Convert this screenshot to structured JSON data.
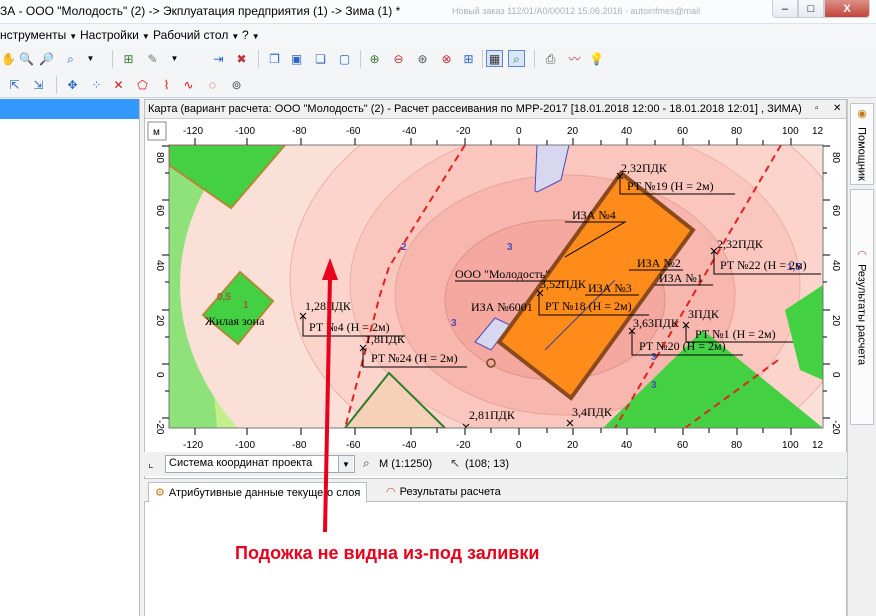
{
  "window": {
    "title": "ЗА - ООО \"Молодость\" (2) -> Экплуатация предприятия (1) -> Зима (1) *",
    "title_extra": "Новый заказ 112/01/А0/00012 15.06.2016 · autoinfmes@mail",
    "min_label": "–",
    "max_label": "□",
    "close_label": "X"
  },
  "menu": {
    "items": [
      {
        "label": "нструменты"
      },
      {
        "label": "Настройки"
      },
      {
        "label": "Рабочий стол"
      },
      {
        "label": "?"
      }
    ]
  },
  "map": {
    "title": "Карта (вариант расчета: ООО \"Молодость\" (2) - Расчет рассеивания по МРР-2017 [18.01.2018 12:00 - 18.01.2018 12:01] , ЗИМА)",
    "unit_label": "м",
    "x_ticks": [
      "-120",
      "-100",
      "-80",
      "-60",
      "-40",
      "-20",
      "0",
      "20",
      "40",
      "60",
      "80",
      "100",
      "12"
    ],
    "y_ticks": [
      "80",
      "60",
      "40",
      "20",
      "0",
      "-20"
    ],
    "residential_zone_label": "Жилая зона",
    "enterprise_label": "ООО \"Молодость\"",
    "sources": [
      {
        "label": "ИЗА №4"
      },
      {
        "label": "ИЗА №2"
      },
      {
        "label": "ИЗА №1"
      },
      {
        "label": "ИЗА №3"
      },
      {
        "label": "ИЗА №6001"
      }
    ],
    "points": [
      {
        "value": "2,32ПДК",
        "name": "РТ №19 (Н = 2м)"
      },
      {
        "value": "2,32ПДК",
        "name": "РТ №22 (Н = 2м)"
      },
      {
        "value": "1,28ПДК",
        "name": "РТ №4 (Н = 2м)"
      },
      {
        "value": "1,8ПДК",
        "name": "РТ №24 (Н = 2м)"
      },
      {
        "value": "3ПДК",
        "name": "РТ №1 (Н = 2м)"
      },
      {
        "value": "3,63ПДК",
        "name": "РТ №20 (Н = 2м)"
      },
      {
        "value": "2,81ПДК",
        "name": ""
      },
      {
        "value": "3,4ПДК",
        "name": ""
      },
      {
        "value": "3,52ПДК",
        "name": "РТ №18 (Н = 2м)"
      }
    ],
    "isoline_labels": [
      "1",
      "3",
      "3",
      "2",
      "1,5",
      "0,5",
      "3",
      "3"
    ]
  },
  "status": {
    "coord_system": "Система координат проекта",
    "scale": "М (1:1250)",
    "cursor": "(108; 13)"
  },
  "tabs": {
    "attr": "Атрибутивные данные текущего слоя",
    "results": "Результаты расчета"
  },
  "side_tabs": {
    "helper": "Помощник",
    "results": "Результаты расчета"
  },
  "annotation": "Подожка не видна из-под заливки",
  "colors": {
    "accent_red": "#e8001c",
    "selection_blue": "#3399ff",
    "building_orange": "#ff8c1a",
    "zone_green": "#3ed23e"
  }
}
